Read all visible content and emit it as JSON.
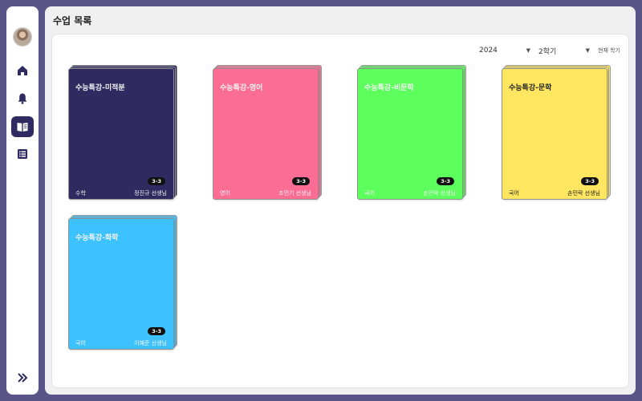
{
  "header": {
    "title": "수업 목록"
  },
  "filters": {
    "year": "2024",
    "semester": "2학기",
    "current_term": "현재 학기"
  },
  "sidebar": {
    "items": [
      {
        "name": "home",
        "icon": "home-icon"
      },
      {
        "name": "notifications",
        "icon": "bell-icon"
      },
      {
        "name": "classes",
        "icon": "book-icon",
        "active": true
      },
      {
        "name": "list",
        "icon": "list-icon"
      }
    ],
    "expand_icon": "double-chevron-right-icon"
  },
  "courses": [
    {
      "title": "수능특강-미적분",
      "subject": "수학",
      "teacher": "정진규 선생님",
      "badge": "3-3",
      "color": "#2f2a5f"
    },
    {
      "title": "수능특강-영어",
      "subject": "영어",
      "teacher": "조민기 선생님",
      "badge": "3-3",
      "color": "#fc6d96"
    },
    {
      "title": "수능특강-비문학",
      "subject": "국어",
      "teacher": "손민락 선생님",
      "badge": "3-3",
      "color": "#5cff5c"
    },
    {
      "title": "수능특강-문학",
      "subject": "국어",
      "teacher": "손민락 선생님",
      "badge": "3-3",
      "color": "#ffe660"
    },
    {
      "title": "수능특강-화학",
      "subject": "국어",
      "teacher": "이혜준 선생님",
      "badge": "3-3",
      "color": "#3ec2ff"
    }
  ]
}
